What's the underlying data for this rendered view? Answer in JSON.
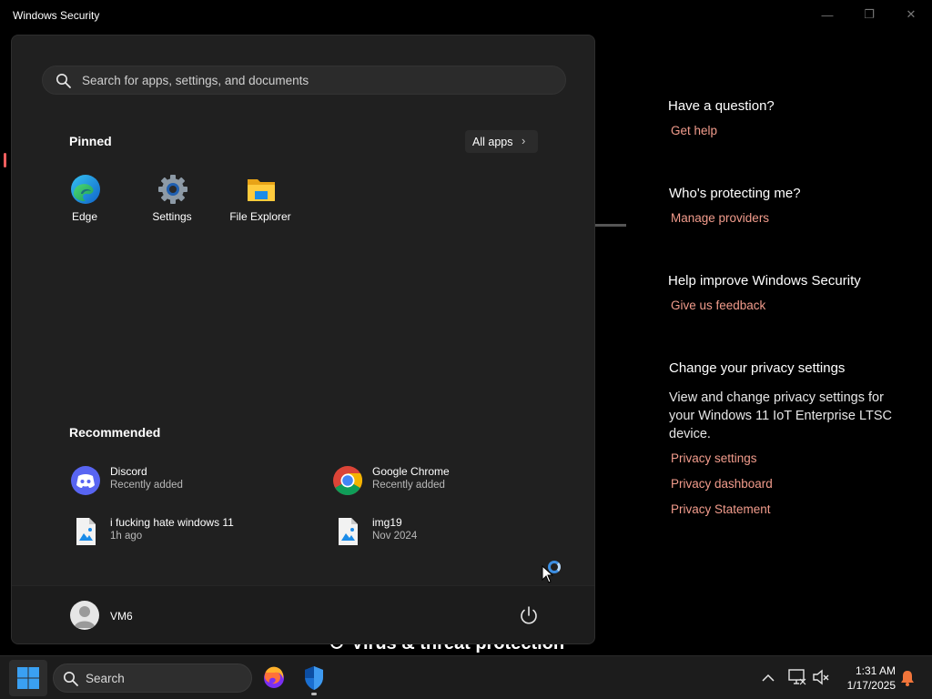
{
  "window": {
    "title": "Windows Security",
    "controls": {
      "minimize": "—",
      "maximize": "❐",
      "close": "✕"
    }
  },
  "side_panel": {
    "question_heading": "Have a question?",
    "get_help": "Get help",
    "protecting_heading": "Who's protecting me?",
    "manage_providers": "Manage providers",
    "improve_heading": "Help improve Windows Security",
    "give_feedback": "Give us feedback",
    "privacy_heading": "Change your privacy settings",
    "privacy_text": "View and change privacy settings for your Windows 11 IoT Enterprise LTSC device.",
    "privacy_settings": "Privacy settings",
    "privacy_dashboard": "Privacy dashboard",
    "privacy_statement": "Privacy Statement",
    "link_color": "#f29c8c"
  },
  "behind_menu": {
    "section_title": "Virus & threat protection"
  },
  "start_menu": {
    "search_placeholder": "Search for apps, settings, and documents",
    "pinned_title": "Pinned",
    "all_apps_label": "All apps",
    "pinned": [
      {
        "label": "Edge",
        "icon": "edge-icon"
      },
      {
        "label": "Settings",
        "icon": "settings-gear-icon"
      },
      {
        "label": "File Explorer",
        "icon": "folder-icon"
      }
    ],
    "recommended_title": "Recommended",
    "recommended": [
      {
        "name": "Discord",
        "sub": "Recently added",
        "icon": "discord-icon"
      },
      {
        "name": "Google Chrome",
        "sub": "Recently added",
        "icon": "chrome-icon"
      },
      {
        "name": "i fucking hate windows 11",
        "sub": "1h ago",
        "icon": "image-file-icon"
      },
      {
        "name": "img19",
        "sub": "Nov 2024",
        "icon": "image-file-icon"
      }
    ],
    "user_name": "VM6"
  },
  "taskbar": {
    "search_placeholder": "Search",
    "time": "1:31 AM",
    "date": "1/17/2025",
    "apps": [
      "firefox-icon",
      "windows-security-shield-icon"
    ],
    "accent_color": "#3b8de0"
  }
}
